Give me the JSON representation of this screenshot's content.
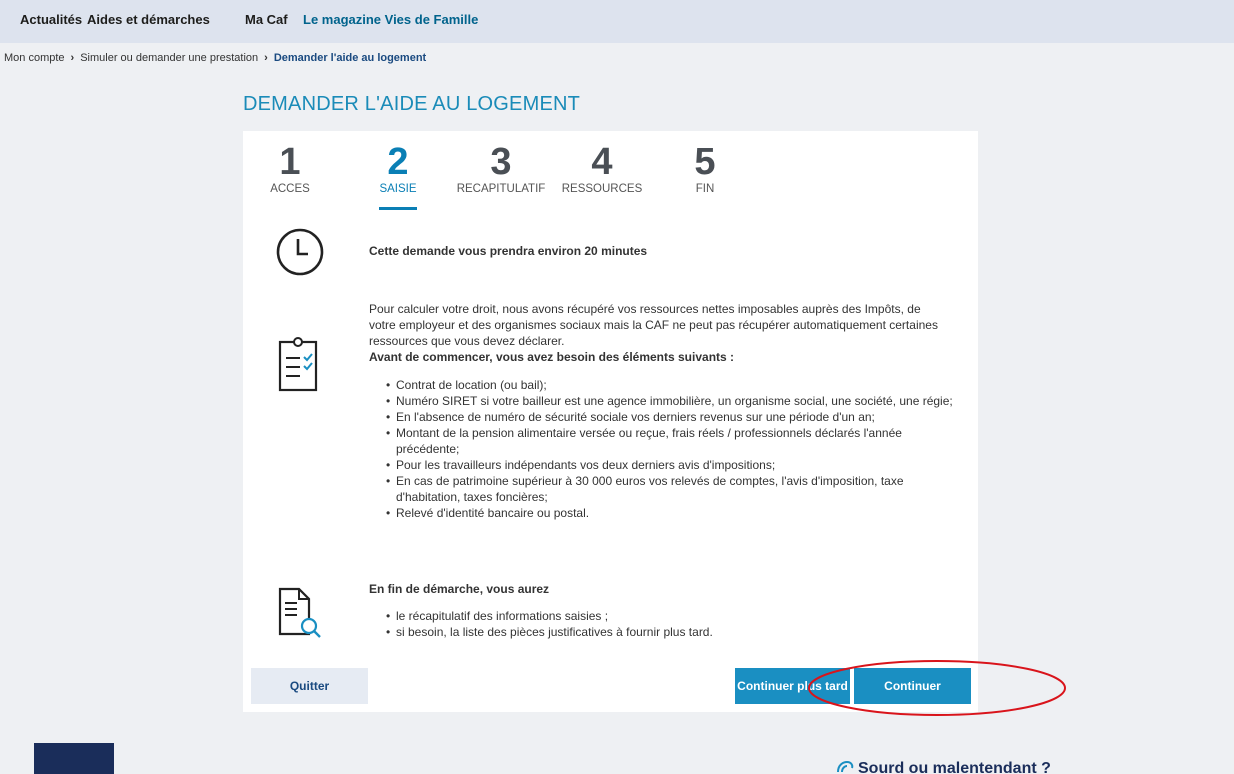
{
  "topnav": {
    "items": [
      "Actualités",
      "Aides et démarches",
      "Ma Caf",
      "Le magazine Vies de Famille"
    ]
  },
  "breadcrumb": {
    "items": [
      "Mon compte",
      "Simuler ou demander une prestation"
    ],
    "current": "Demander l'aide au logement"
  },
  "page": {
    "title": "DEMANDER L'AIDE AU LOGEMENT"
  },
  "steps": [
    {
      "num": "1",
      "label": "ACCES"
    },
    {
      "num": "2",
      "label": "SAISIE"
    },
    {
      "num": "3",
      "label": "RECAPITULATIF"
    },
    {
      "num": "4",
      "label": "RESSOURCES"
    },
    {
      "num": "5",
      "label": "FIN"
    }
  ],
  "duration": "Cette demande vous prendra environ 20 minutes",
  "intro": {
    "line1": "Pour calculer votre droit, nous avons récupéré vos ressources nettes imposables auprès des Impôts, de",
    "line2": "votre employeur et des organismes sociaux mais la CAF ne peut pas récupérer automatiquement certaines",
    "line3": "ressources que vous devez déclarer.",
    "heading": "Avant de commencer, vous avez besoin des éléments suivants :"
  },
  "requirements": [
    "Contrat de location (ou bail);",
    "Numéro SIRET si votre bailleur est une agence immobilière, un organisme social, une société, une régie;",
    "En l'absence de numéro de sécurité sociale vos derniers revenus sur une période d'un an;",
    "Montant de la pension alimentaire versée ou reçue, frais réels / professionnels déclarés l'année précédente;",
    "Pour les travailleurs indépendants vos deux derniers avis d'impositions;",
    "En cas de patrimoine supérieur à 30 000 euros vos relevés de comptes, l'avis d'imposition, taxe d'habitation, taxes foncières;",
    "Relevé d'identité bancaire ou postal."
  ],
  "end": {
    "heading": "En fin de démarche, vous aurez",
    "items": [
      "le récapitulatif des informations saisies ;",
      "si besoin, la liste des pièces justificatives à fournir plus tard."
    ]
  },
  "buttons": {
    "quit": "Quitter",
    "later": "Continuer plus tard",
    "continue": "Continuer"
  },
  "footer": {
    "deaf": "Sourd ou malentendant ?"
  },
  "colors": {
    "accent": "#0a7fb5",
    "button": "#1a8fc2",
    "navy": "#1a2d5a",
    "annotation": "#d9141b"
  },
  "icons": [
    "clock-icon",
    "clipboard-checklist-icon",
    "document-search-icon",
    "ear-icon"
  ]
}
